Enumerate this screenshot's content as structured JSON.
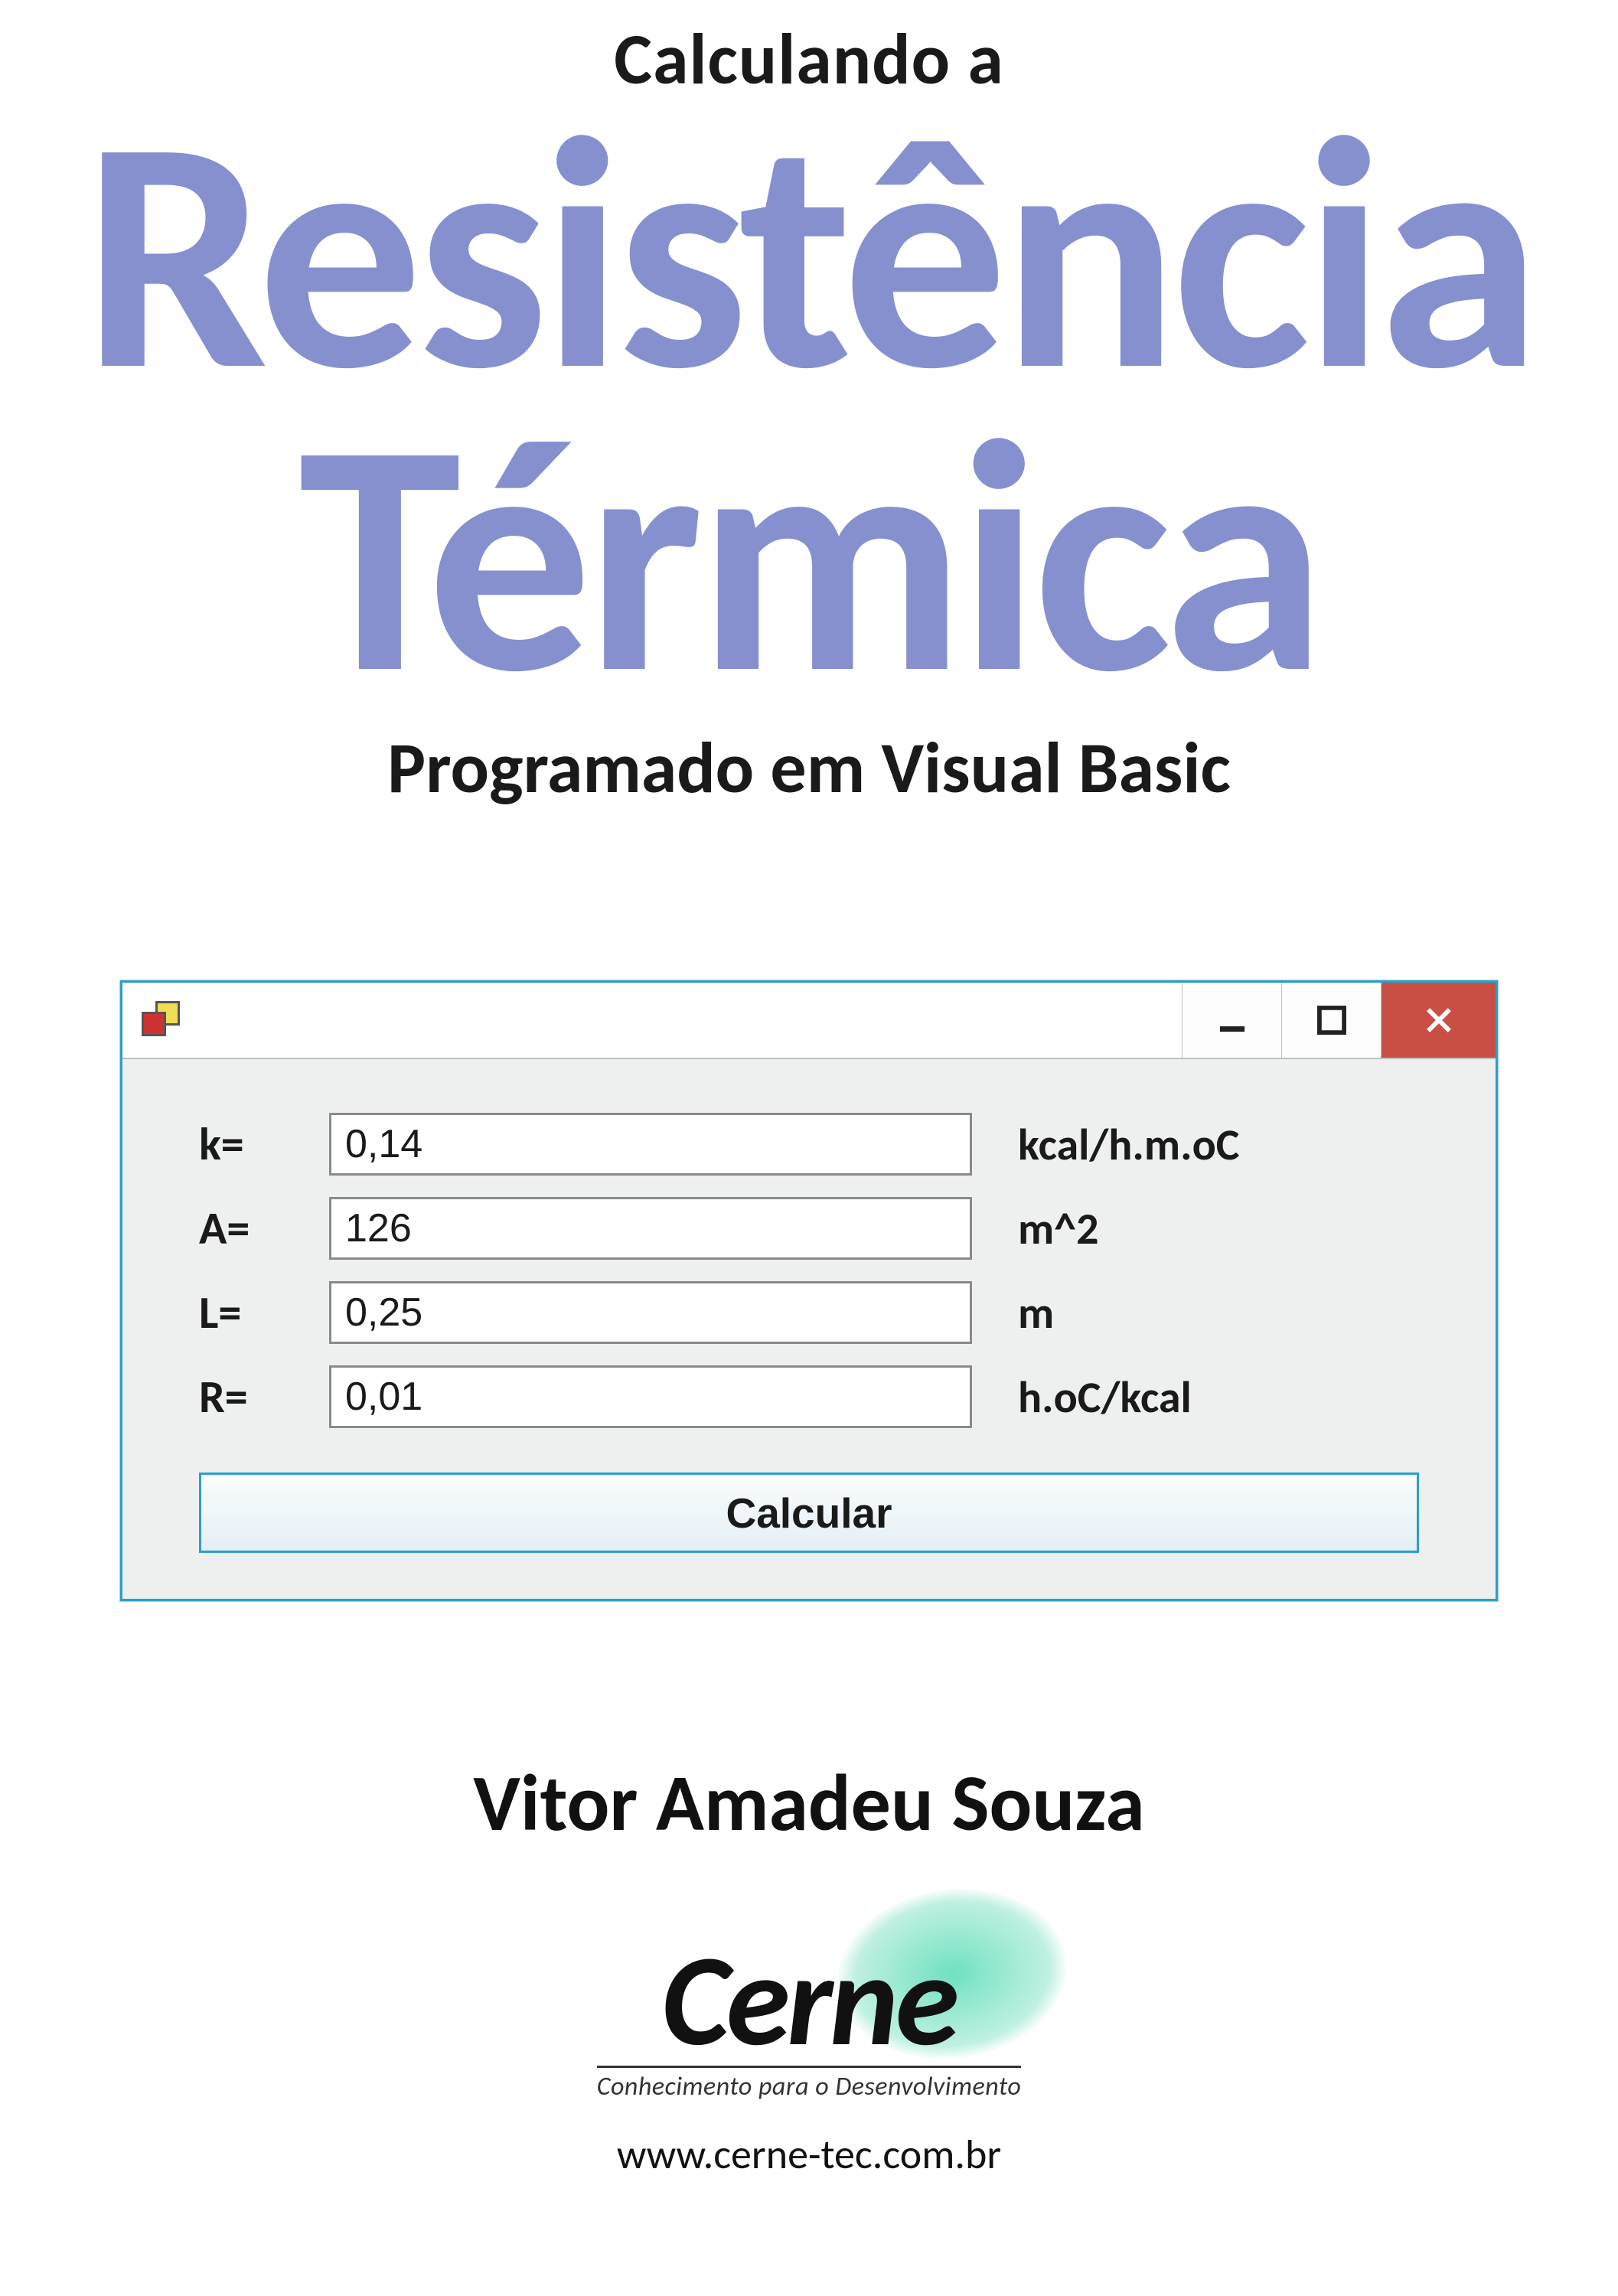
{
  "header": {
    "supertitle": "Calculando a",
    "title_line1": "Resistência",
    "title_line2": "Térmica",
    "subtitle": "Programado em Visual Basic"
  },
  "window": {
    "controls": {
      "minimize_glyph": "—",
      "maximize_glyph": "□",
      "close_glyph": "×"
    },
    "fields": [
      {
        "label": "k=",
        "value": "0,14",
        "unit": "kcal/h.m.oC"
      },
      {
        "label": "A=",
        "value": "126",
        "unit": "m^2"
      },
      {
        "label": "L=",
        "value": "0,25",
        "unit": "m"
      },
      {
        "label": "R=",
        "value": "0,01",
        "unit": "h.oC/kcal"
      }
    ],
    "calc_button": "Calcular"
  },
  "footer": {
    "author": "Vitor Amadeu Souza",
    "logo_text": "Cerne",
    "logo_tag": "Conhecimento para o Desenvolvimento",
    "logo_url": "www.cerne-tec.com.br"
  }
}
